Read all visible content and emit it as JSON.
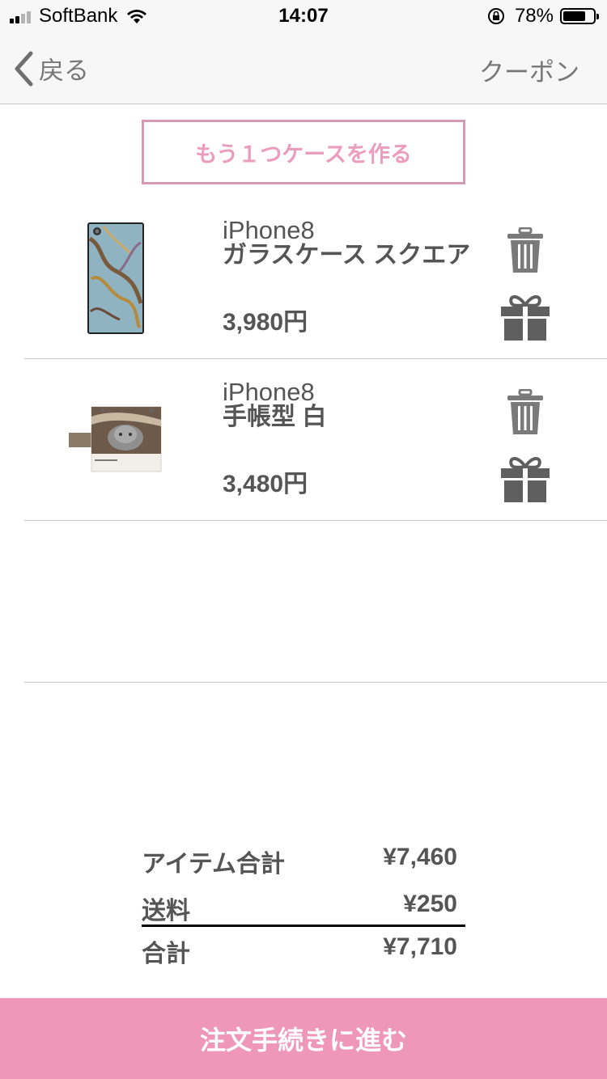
{
  "status_bar": {
    "carrier": "SoftBank",
    "time": "14:07",
    "battery": "78%",
    "battery_level": 0.78
  },
  "nav": {
    "back_label": "戻る",
    "coupon_label": "クーポン"
  },
  "add_case_label": "もう１つケースを作る",
  "cart_items": [
    {
      "model": "iPhone8",
      "name": "ガラスケース スクエア",
      "price": "3,980円",
      "thumbnail": "marble-case-image"
    },
    {
      "model": "iPhone8",
      "name": "手帳型 白",
      "price": "3,480円",
      "thumbnail": "cat-notebook-case-image"
    }
  ],
  "totals": {
    "items_label": "アイテム合計",
    "items_value": "¥7,460",
    "shipping_label": "送料",
    "shipping_value": "¥250",
    "total_label": "合計",
    "total_value": "¥7,710"
  },
  "checkout_label": "注文手続きに進む",
  "colors": {
    "accent_pink": "#ef97b8",
    "icon_gray": "#5f5f5f"
  }
}
